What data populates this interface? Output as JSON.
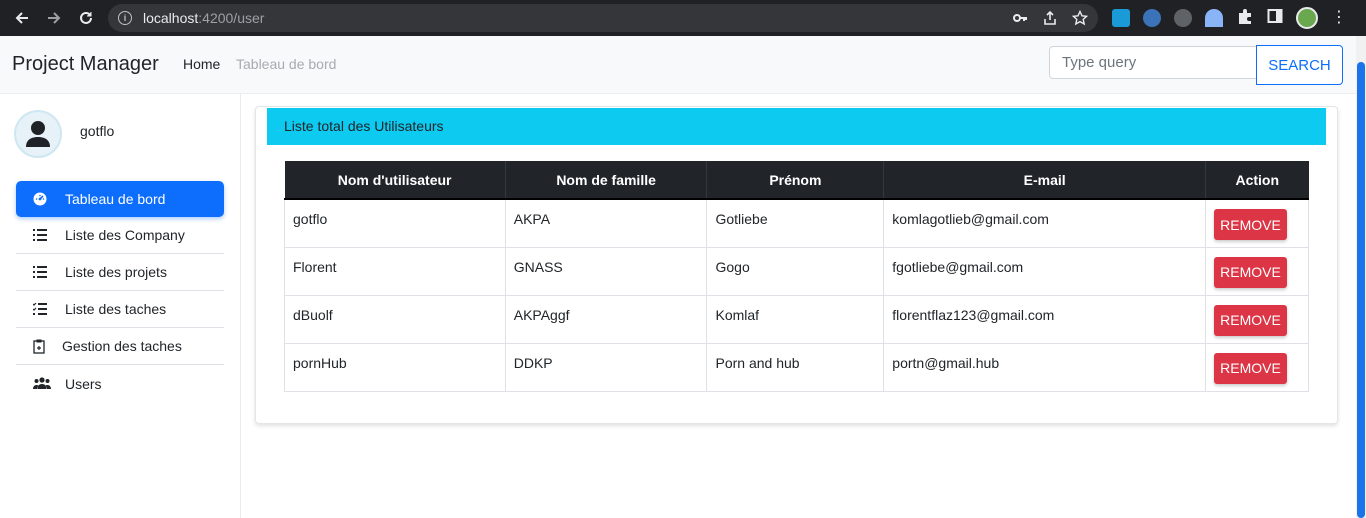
{
  "browser": {
    "url_host": "localhost",
    "url_rest": ":4200/user"
  },
  "navbar": {
    "brand": "Project Manager",
    "links": [
      "Home",
      "Tableau de bord"
    ],
    "search_placeholder": "Type query",
    "search_button": "SEARCH"
  },
  "sidebar": {
    "user_name": "gotflo",
    "items": [
      {
        "label": "Tableau de bord",
        "icon": "dashboard-icon",
        "active": true
      },
      {
        "label": "Liste des Company",
        "icon": "list-icon"
      },
      {
        "label": "Liste des projets",
        "icon": "list-icon"
      },
      {
        "label": "Liste des taches",
        "icon": "checklist-icon"
      },
      {
        "label": "Gestion des taches",
        "icon": "clipboard-icon"
      },
      {
        "label": "Users",
        "icon": "users-icon"
      }
    ]
  },
  "main": {
    "card_title": "Liste total des Utilisateurs",
    "table": {
      "headers": [
        "Nom d'utilisateur",
        "Nom de famille",
        "Prénom",
        "E-mail",
        "Action"
      ],
      "rows": [
        [
          "gotflo",
          "AKPA",
          "Gotliebe",
          "komlagotlieb@gmail.com"
        ],
        [
          "Florent",
          "GNASS",
          "Gogo",
          "fgotliebe@gmail.com"
        ],
        [
          "dBuolf",
          "AKPAggf",
          "Komlaf",
          "florentflaz123@gmail.com"
        ],
        [
          "pornHub",
          "DDKP",
          "Porn and hub",
          "portn@gmail.hub"
        ]
      ],
      "action_label": "REMOVE"
    }
  },
  "colors": {
    "primary": "#0d6efd",
    "info": "#0dcaf0",
    "danger": "#dc3545",
    "dark": "#212529"
  }
}
